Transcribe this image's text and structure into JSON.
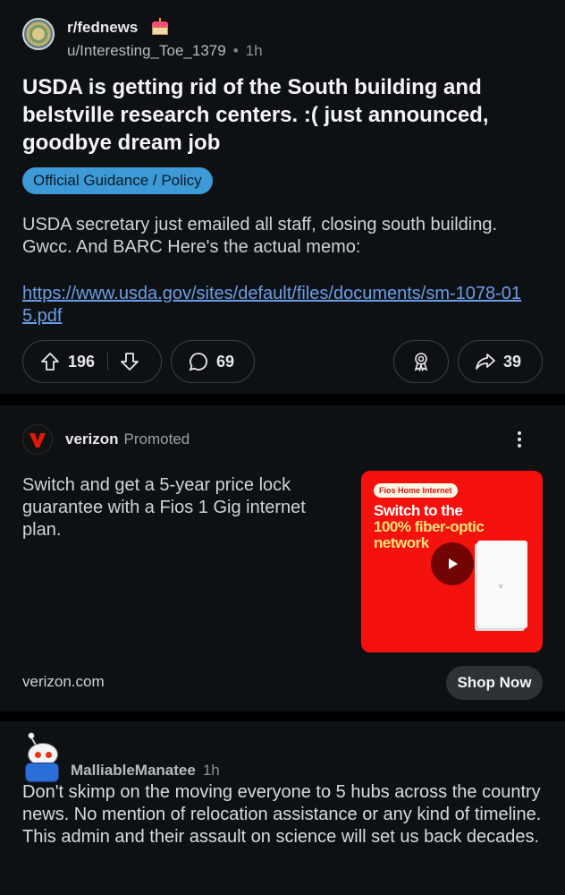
{
  "post": {
    "subreddit": "r/fednews",
    "author": "u/Interesting_Toe_1379",
    "separator": "•",
    "time": "1h",
    "title": "USDA is getting rid of the South building and belstville research centers. :( just announced, goodbye dream job",
    "flair": "Official Guidance / Policy",
    "body": "USDA secretary just emailed all staff, closing south building. Gwcc. And BARC Here's the actual memo:",
    "link": "https://www.usda.gov/sites/default/files/documents/sm-1078-015.pdf",
    "votes": "196",
    "comments": "69",
    "shares": "39"
  },
  "ad": {
    "advertiser": "verizon",
    "label": "Promoted",
    "text": "Switch and get a 5-year price lock guarantee with a Fios 1 Gig internet plan.",
    "image": {
      "tag": "Fios Home Internet",
      "headline_1": "Switch to the",
      "headline_2": "100% fiber-optic",
      "headline_3": "network"
    },
    "domain": "verizon.com",
    "cta": "Shop Now"
  },
  "comment": {
    "author": "MalliableManatee",
    "time": "1h",
    "body": "Don't skimp on the moving everyone to 5 hubs across the country news. No mention of relocation assistance or any kind of timeline. This admin and their assault on science will set us back decades."
  },
  "colors": {
    "background": "#0e1113",
    "flair": "#3d9ad6",
    "link": "#6b9ee8",
    "ad_image": "#f5120e"
  }
}
